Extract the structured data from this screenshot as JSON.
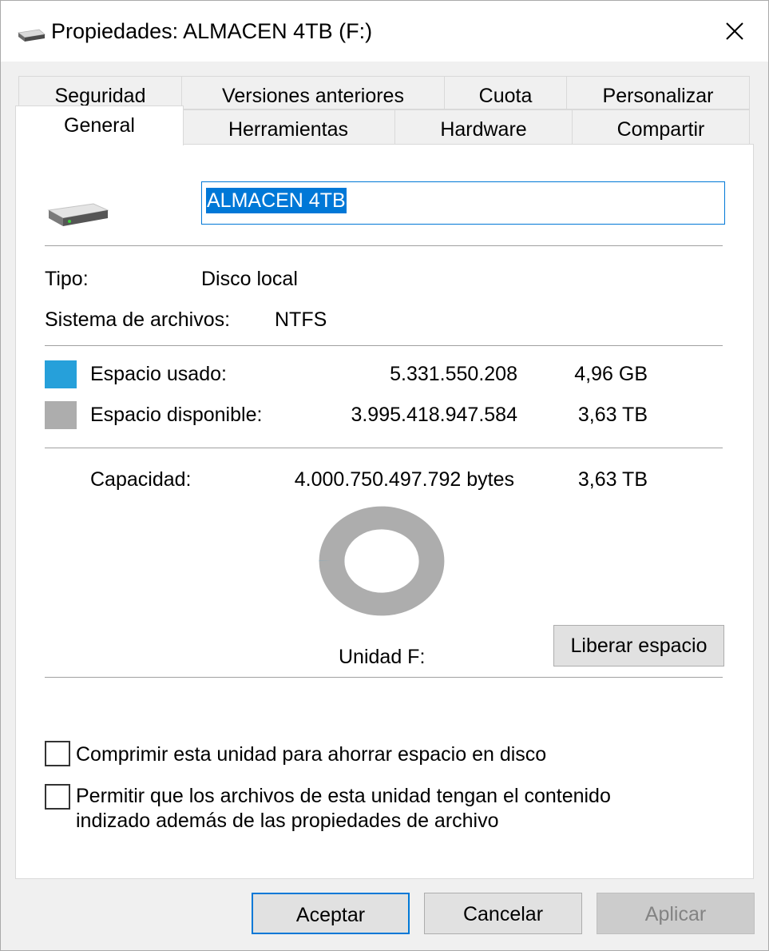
{
  "window": {
    "title": "Propiedades: ALMACEN 4TB (F:)",
    "icons": {
      "title": "drive-icon",
      "close": "close-icon"
    }
  },
  "tabs": {
    "row1": [
      "Seguridad",
      "Versiones anteriores",
      "Cuota",
      "Personalizar"
    ],
    "row2": [
      "General",
      "Herramientas",
      "Hardware",
      "Compartir"
    ],
    "active": "General"
  },
  "general": {
    "drive_icon": "hard-drive-icon",
    "name_value": "ALMACEN 4TB",
    "type_label": "Tipo:",
    "type_value": "Disco local",
    "fs_label": "Sistema de archivos:",
    "fs_value": "NTFS",
    "used": {
      "label": "Espacio usado:",
      "bytes": "5.331.550.208",
      "size": "4,96 GB",
      "color": "#26a0da"
    },
    "free": {
      "label": "Espacio disponible:",
      "bytes": "3.995.418.947.584",
      "size": "3,63 TB",
      "color": "#adadad"
    },
    "capacity": {
      "label": "Capacidad:",
      "bytes": "4.000.750.497.792 bytes",
      "size": "3,63 TB"
    },
    "drive_label": "Unidad F:",
    "cleanup_button": "Liberar espacio",
    "compress_label": "Comprimir esta unidad para ahorrar espacio en disco",
    "compress_checked": false,
    "index_label_line1": "Permitir que los archivos de esta unidad tengan el contenido",
    "index_label_line2": "indizado además de las propiedades de archivo",
    "index_checked": false
  },
  "chart_data": {
    "type": "pie",
    "categories": [
      "Espacio usado",
      "Espacio disponible"
    ],
    "values": [
      5331550208,
      3995418947584
    ]
  },
  "footer": {
    "ok": "Aceptar",
    "cancel": "Cancelar",
    "apply": "Aplicar"
  }
}
